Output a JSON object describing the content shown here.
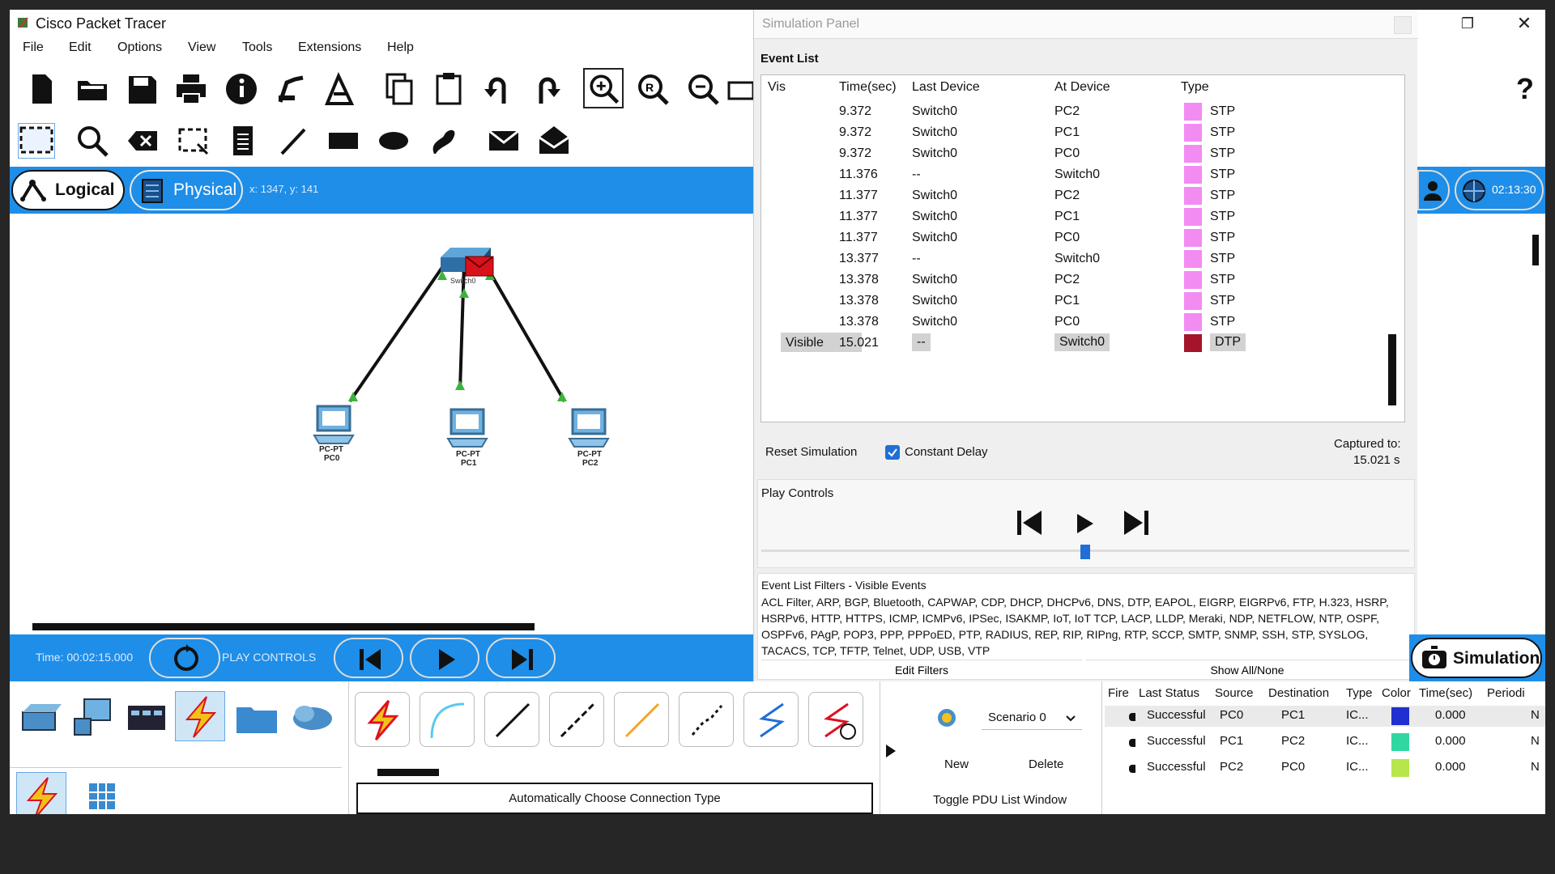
{
  "window": {
    "title": "Cisco Packet Tracer"
  },
  "menu": [
    "File",
    "Edit",
    "Options",
    "View",
    "Tools",
    "Extensions",
    "Help"
  ],
  "workspace": {
    "logical_label": "Logical",
    "physical_label": "Physical",
    "coords": "x: 1347, y: 141",
    "clock": "02:13:30"
  },
  "topology": {
    "switch": {
      "label": "Switch0"
    },
    "pcs": [
      {
        "type": "PC-PT",
        "name": "PC0"
      },
      {
        "type": "PC-PT",
        "name": "PC1"
      },
      {
        "type": "PC-PT",
        "name": "PC2"
      }
    ]
  },
  "bottombar": {
    "time": "Time: 00:02:15.000",
    "play_controls": "PLAY CONTROLS"
  },
  "simulation_panel": {
    "title": "Simulation Panel",
    "event_list_label": "Event List",
    "columns": [
      "Vis",
      "Time(sec)",
      "Last Device",
      "At Device",
      "Type"
    ],
    "events": [
      {
        "vis": "",
        "time": "9.372",
        "last": "Switch0",
        "at": "PC2",
        "type": "STP",
        "color": "#f28cf2"
      },
      {
        "vis": "",
        "time": "9.372",
        "last": "Switch0",
        "at": "PC1",
        "type": "STP",
        "color": "#f28cf2"
      },
      {
        "vis": "",
        "time": "9.372",
        "last": "Switch0",
        "at": "PC0",
        "type": "STP",
        "color": "#f28cf2"
      },
      {
        "vis": "",
        "time": "11.376",
        "last": "--",
        "at": "Switch0",
        "type": "STP",
        "color": "#f28cf2"
      },
      {
        "vis": "",
        "time": "11.377",
        "last": "Switch0",
        "at": "PC2",
        "type": "STP",
        "color": "#f28cf2"
      },
      {
        "vis": "",
        "time": "11.377",
        "last": "Switch0",
        "at": "PC1",
        "type": "STP",
        "color": "#f28cf2"
      },
      {
        "vis": "",
        "time": "11.377",
        "last": "Switch0",
        "at": "PC0",
        "type": "STP",
        "color": "#f28cf2"
      },
      {
        "vis": "",
        "time": "13.377",
        "last": "--",
        "at": "Switch0",
        "type": "STP",
        "color": "#f28cf2"
      },
      {
        "vis": "",
        "time": "13.378",
        "last": "Switch0",
        "at": "PC2",
        "type": "STP",
        "color": "#f28cf2"
      },
      {
        "vis": "",
        "time": "13.378",
        "last": "Switch0",
        "at": "PC1",
        "type": "STP",
        "color": "#f28cf2"
      },
      {
        "vis": "",
        "time": "13.378",
        "last": "Switch0",
        "at": "PC0",
        "type": "STP",
        "color": "#f28cf2"
      },
      {
        "vis": "Visible",
        "time": "15.021",
        "last": "--",
        "at": "Switch0",
        "type": "DTP",
        "color": "#a5142a"
      }
    ],
    "reset_simulation": "Reset Simulation",
    "constant_delay": "Constant Delay",
    "captured_to_label": "Captured to:",
    "captured_to_value": "15.021 s",
    "play_controls_label": "Play Controls",
    "filters_title": "Event List Filters - Visible Events",
    "filters_text": "ACL Filter, ARP, BGP, Bluetooth, CAPWAP, CDP, DHCP, DHCPv6, DNS, DTP, EAPOL, EIGRP, EIGRPv6, FTP, H.323, HSRP, HSRPv6, HTTP, HTTPS, ICMP, ICMPv6, IPSec, ISAKMP, IoT, IoT TCP, LACP, LLDP, Meraki, NDP, NETFLOW, NTP, OSPF, OSPFv6, PAgP, POP3, PPP, PPPoED, PTP, RADIUS, REP, RIP, RIPng, RTP, SCCP, SMTP, SNMP, SSH, STP, SYSLOG, TACACS, TCP, TFTP, Telnet, UDP, USB, VTP",
    "edit_filters": "Edit Filters",
    "show_all_none": "Show All/None"
  },
  "mode_button": "Simulation",
  "connection_type_label": "Automatically Choose Connection Type",
  "scenario": {
    "selected": "Scenario 0",
    "new": "New",
    "delete": "Delete",
    "toggle": "Toggle PDU List Window"
  },
  "pdu_list": {
    "columns": [
      "Fire",
      "Last Status",
      "Source",
      "Destination",
      "Type",
      "Color",
      "Time(sec)",
      "Periodi"
    ],
    "rows": [
      {
        "status": "Successful",
        "src": "PC0",
        "dst": "PC1",
        "type": "IC...",
        "color": "#1f2fd0",
        "time": "0.000",
        "periodic": "N"
      },
      {
        "status": "Successful",
        "src": "PC1",
        "dst": "PC2",
        "type": "IC...",
        "color": "#2fd8a0",
        "time": "0.000",
        "periodic": "N"
      },
      {
        "status": "Successful",
        "src": "PC2",
        "dst": "PC0",
        "type": "IC...",
        "color": "#b7e64a",
        "time": "0.000",
        "periodic": "N"
      }
    ]
  }
}
